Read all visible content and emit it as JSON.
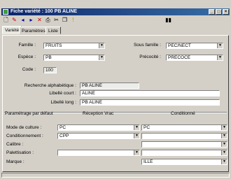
{
  "window": {
    "title": "Fiche variété : 100  PB ALINE"
  },
  "toolbar": {
    "icons": [
      "new-doc-icon",
      "edit-icon",
      "prev-icon",
      "next-icon",
      "delete-icon",
      "print-icon",
      "cut-icon",
      "copy-icon",
      "warning-icon",
      "unknown-icon"
    ]
  },
  "tabs": [
    {
      "label": "Variété"
    },
    {
      "label": "Paramètres"
    },
    {
      "label": "Liste"
    }
  ],
  "form": {
    "famille": {
      "label": "Famille :",
      "value": "FRUITS"
    },
    "sous_famille": {
      "label": "Sous famille :",
      "value": "PEC/NECT"
    },
    "espece": {
      "label": "Espèce :",
      "value": "PB"
    },
    "precocite": {
      "label": "Précocité :",
      "value": "PRECOCE"
    },
    "code": {
      "label": "Code :",
      "value": "100"
    },
    "recherche": {
      "label": "Recherche alphabétique :",
      "value": "PB ALINE"
    },
    "libelle_court": {
      "label": "Libellé court :",
      "value": "ALINE"
    },
    "libelle_long": {
      "label": "Libellé long :",
      "value": "PB ALINE"
    }
  },
  "params": {
    "section_label": "Paramétrage par défaut",
    "col_reception": "Réception Vrac",
    "col_conditionnement": "Conditionné",
    "rows": [
      {
        "label": "Mode de culture :",
        "reception": "PC",
        "conditionne": "PC"
      },
      {
        "label": "Conditionnement :",
        "reception": "CPP",
        "conditionne": ""
      },
      {
        "label": "Calibre :",
        "reception": "",
        "conditionne": ""
      },
      {
        "label": "Palettisation :",
        "reception": "",
        "conditionne": ""
      },
      {
        "label": "Marque :",
        "reception": "",
        "conditionne": "ILLE"
      }
    ]
  }
}
